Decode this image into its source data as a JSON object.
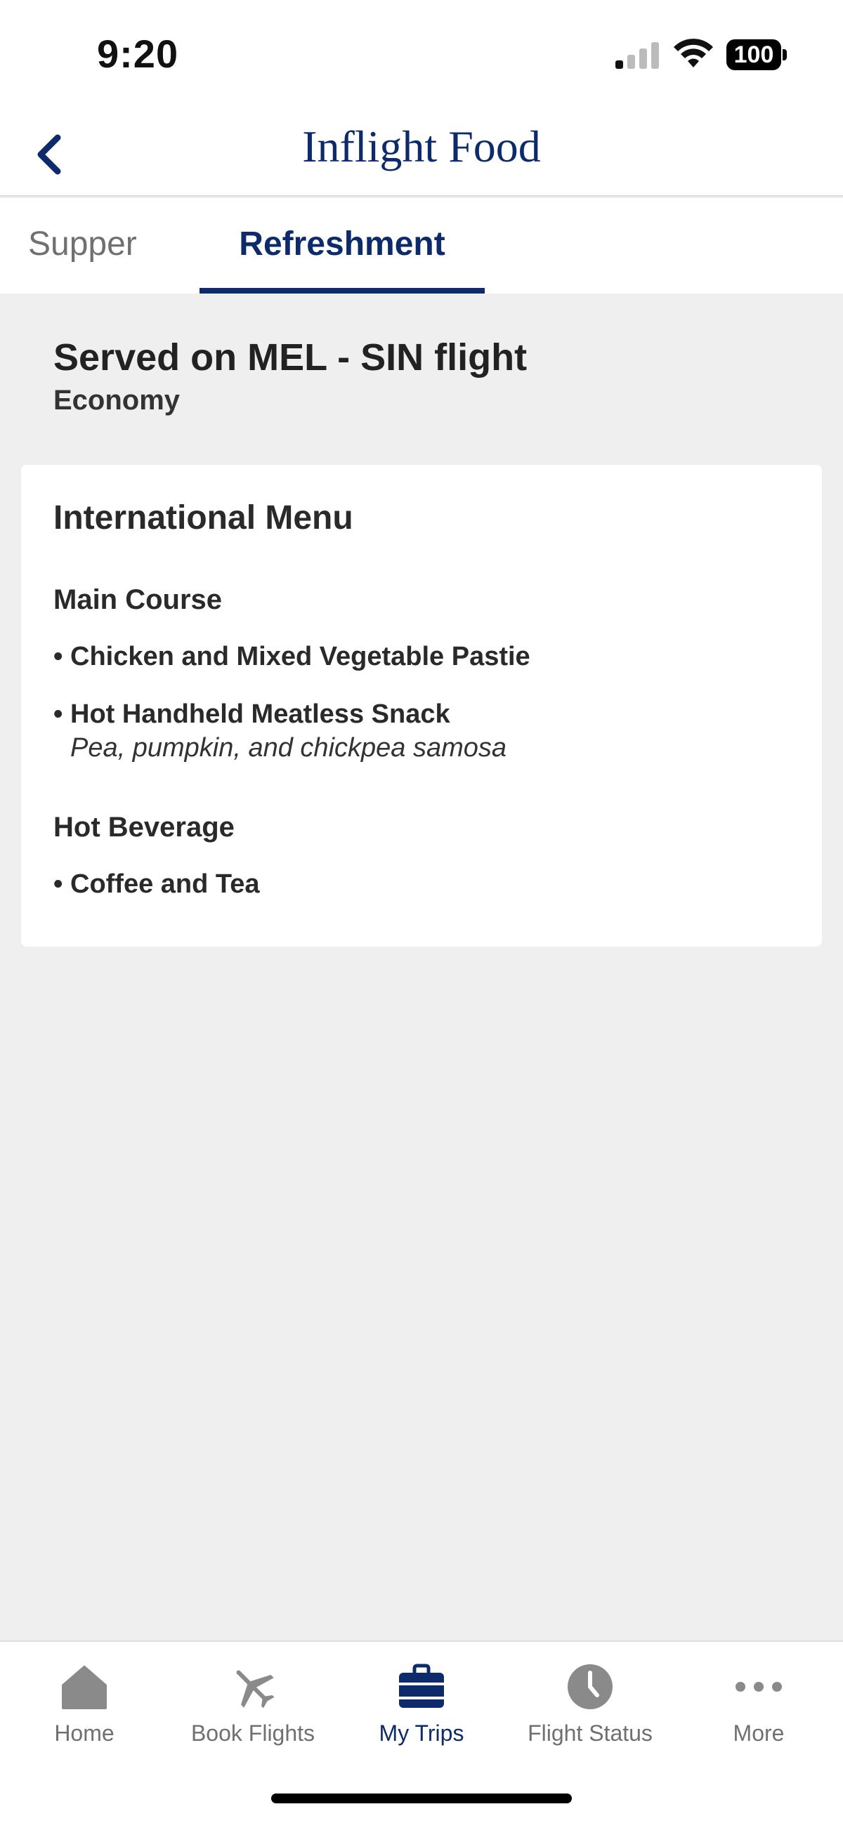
{
  "status_bar": {
    "time": "9:20",
    "battery": "100",
    "icons": [
      "signal-icon",
      "wifi-icon",
      "battery-icon"
    ]
  },
  "header": {
    "title": "Inflight Food",
    "back_icon": "chevron-left-icon"
  },
  "tabs": [
    {
      "label": "Supper",
      "active": false
    },
    {
      "label": "Refreshment",
      "active": true
    }
  ],
  "flight": {
    "served_on": "Served on MEL - SIN flight",
    "cabin": "Economy"
  },
  "menu": {
    "title": "International Menu",
    "sections": [
      {
        "title": "Main Course",
        "items": [
          {
            "name": "Chicken and Mixed Vegetable Pastie",
            "description": ""
          },
          {
            "name": "Hot Handheld Meatless Snack",
            "description": "Pea, pumpkin, and chickpea samosa"
          }
        ]
      },
      {
        "title": "Hot Beverage",
        "items": [
          {
            "name": "Coffee and Tea",
            "description": ""
          }
        ]
      }
    ],
    "bullet": "•"
  },
  "tabbar": {
    "items": [
      {
        "label": "Home",
        "icon": "home-icon",
        "active": false
      },
      {
        "label": "Book Flights",
        "icon": "airplane-icon",
        "active": false
      },
      {
        "label": "My Trips",
        "icon": "suitcase-icon",
        "active": true
      },
      {
        "label": "Flight Status",
        "icon": "clock-icon",
        "active": false
      },
      {
        "label": "More",
        "icon": "more-dots-icon",
        "active": false
      }
    ]
  },
  "colors": {
    "brand": "#0d2a6b",
    "inactive": "#707070",
    "background": "#efefef"
  }
}
